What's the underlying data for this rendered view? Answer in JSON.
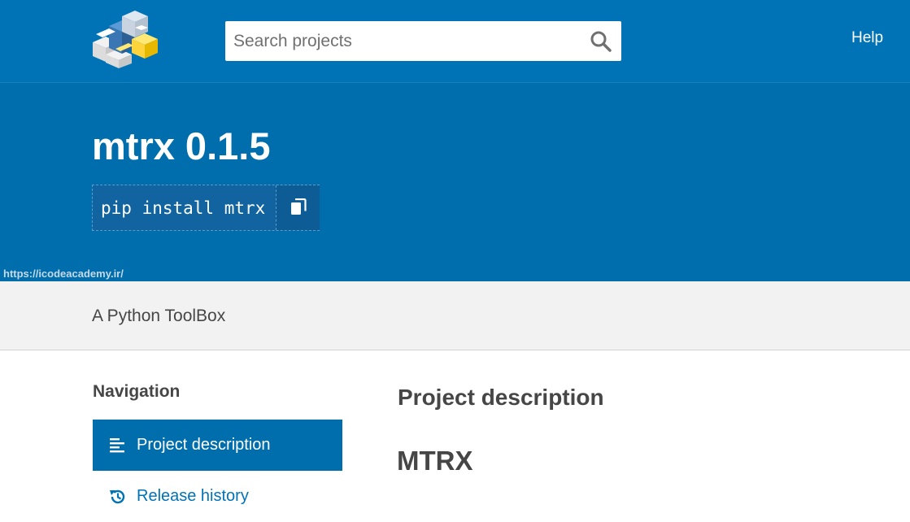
{
  "header": {
    "logo_icon": "pypi-cubes-logo",
    "search": {
      "placeholder": "Search projects",
      "value": ""
    },
    "search_icon": "search-icon",
    "help_label": "Help"
  },
  "banner": {
    "title": "mtrx 0.1.5",
    "pip_command": "pip install mtrx",
    "copy_icon": "copy-icon",
    "watermark": "https://icodeacademy.ir/"
  },
  "summary": "A Python ToolBox",
  "navigation": {
    "heading": "Navigation",
    "items": [
      {
        "label": "Project description",
        "icon": "align-left-icon",
        "active": true
      },
      {
        "label": "Release history",
        "icon": "history-icon",
        "active": false
      }
    ]
  },
  "content": {
    "section_heading": "Project description",
    "readme_heading": "MTRX"
  },
  "colors": {
    "header_bg": "#0073b7",
    "banner_bg": "#006dad",
    "nav_active_bg": "#006dad",
    "summary_bg": "#f2f2f2",
    "text": "#464646",
    "link": "#0073b7"
  }
}
